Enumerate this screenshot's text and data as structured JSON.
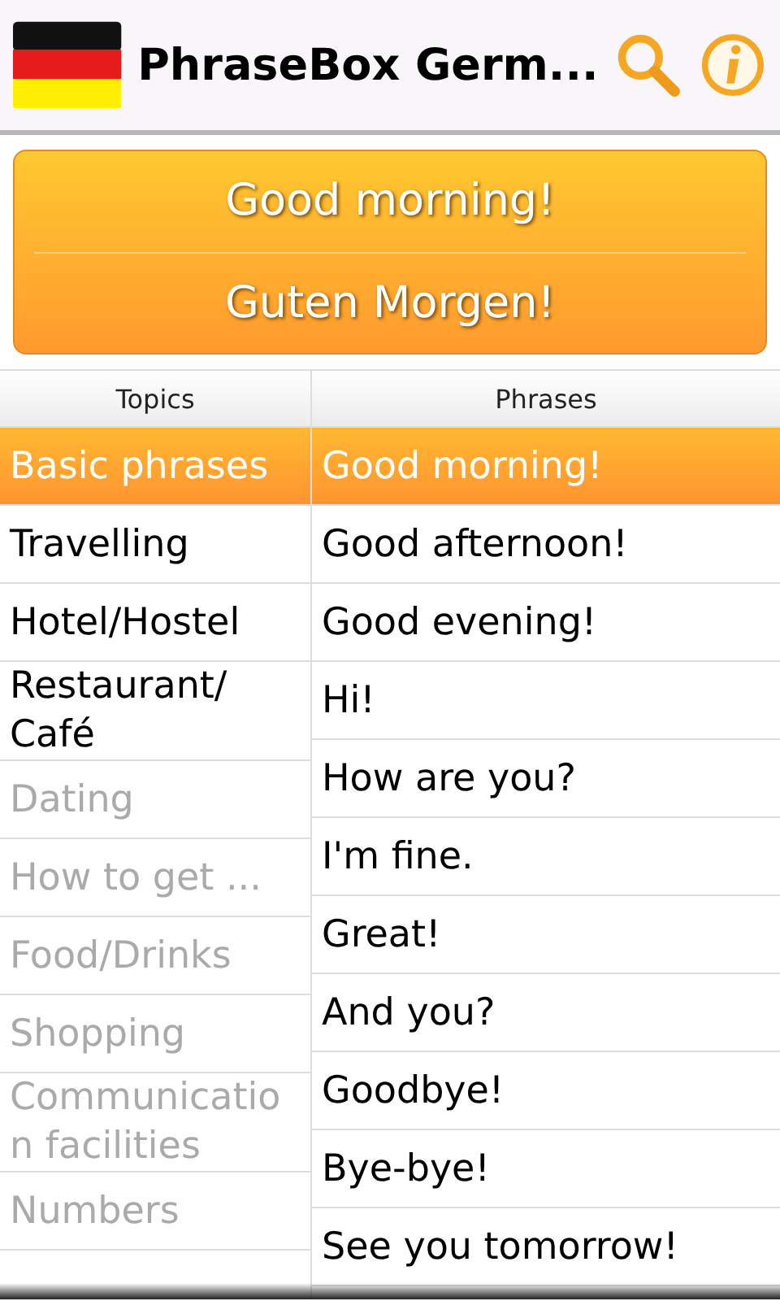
{
  "app_bar": {
    "title": "PhraseBox Germ..."
  },
  "translation_card": {
    "phrase": "Good morning!",
    "translation": "Guten Morgen!"
  },
  "columns": [
    "Topics",
    "Phrases"
  ],
  "topics": [
    {
      "label": "Basic phrases",
      "selected": true,
      "disabled": false
    },
    {
      "label": "Travelling",
      "selected": false,
      "disabled": false
    },
    {
      "label": "Hotel/Hostel",
      "selected": false,
      "disabled": false
    },
    {
      "label": "Restaurant/ Café",
      "selected": false,
      "disabled": false
    },
    {
      "label": "Dating",
      "selected": false,
      "disabled": true
    },
    {
      "label": "How to get ...",
      "selected": false,
      "disabled": true
    },
    {
      "label": "Food/Drinks",
      "selected": false,
      "disabled": true
    },
    {
      "label": "Shopping",
      "selected": false,
      "disabled": true
    },
    {
      "label": "Communication facilities",
      "selected": false,
      "disabled": true
    },
    {
      "label": "Numbers",
      "selected": false,
      "disabled": true
    }
  ],
  "phrases": [
    {
      "label": "Good morning!",
      "selected": true
    },
    {
      "label": "Good afternoon!",
      "selected": false
    },
    {
      "label": "Good evening!",
      "selected": false
    },
    {
      "label": "Hi!",
      "selected": false
    },
    {
      "label": "How are you?",
      "selected": false
    },
    {
      "label": "I'm fine.",
      "selected": false
    },
    {
      "label": "Great!",
      "selected": false
    },
    {
      "label": "And you?",
      "selected": false
    },
    {
      "label": "Goodbye!",
      "selected": false
    },
    {
      "label": "Bye-bye!",
      "selected": false
    },
    {
      "label": "See you tomorrow!",
      "selected": false
    }
  ]
}
